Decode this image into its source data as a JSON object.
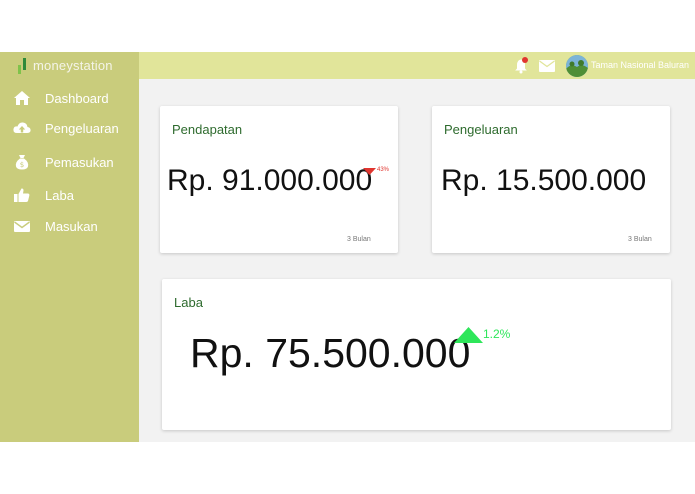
{
  "brand": {
    "name": "moneystation"
  },
  "sidebar": {
    "items": [
      {
        "label": "Dashboard",
        "icon": "home-icon"
      },
      {
        "label": "Pengeluaran",
        "icon": "cloud-upload-icon"
      },
      {
        "label": "Pemasukan",
        "icon": "money-bag-icon"
      },
      {
        "label": "Laba",
        "icon": "thumbs-up-icon"
      },
      {
        "label": "Masukan",
        "icon": "envelope-icon"
      }
    ]
  },
  "topbar": {
    "notifications_icon": "bell-icon",
    "notification_badge_color": "#e0352f",
    "messages_icon": "envelope-icon",
    "user_name": "Taman Nasional Baluran"
  },
  "cards": {
    "pendapatan": {
      "title": "Pendapatan",
      "amount": "Rp. 91.000.000",
      "delta": "43%",
      "delta_direction": "down",
      "period": "3 Bulan"
    },
    "pengeluaran": {
      "title": "Pengeluaran",
      "amount": "Rp. 15.500.000",
      "period": "3 Bulan"
    },
    "laba": {
      "title": "Laba",
      "amount": "Rp. 75.500.000",
      "delta": "1.2%",
      "delta_direction": "up"
    }
  },
  "colors": {
    "sidebar": "#c9cc7c",
    "topbar": "#e1e59a",
    "title_green": "#2e6b2e",
    "down": "#e0352f",
    "up": "#2ee65a"
  }
}
